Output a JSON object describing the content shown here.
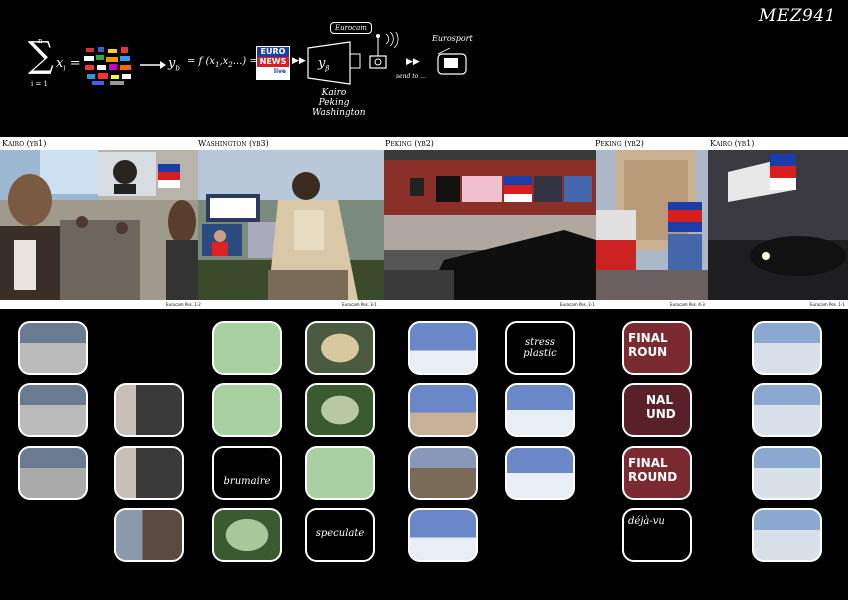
{
  "brand": "MEZ941",
  "formula": {
    "sum_top": "n",
    "sum_bottom": "i = 1",
    "xi": "x",
    "xi_sub": "i",
    "eq": "=",
    "yb": "y",
    "yb_sub": "b",
    "fx": "= f (x",
    "fx_sub1": "1",
    "fx_mid": ",x",
    "fx_sub2": "2",
    "fx_tail": "...) =",
    "ybeta": "y",
    "ybeta_sub": "β",
    "cities": [
      "Kairo",
      "Peking",
      "Washington"
    ],
    "send_to": "send to ...",
    "eurocam": "Eurocam",
    "eurosport": "Eurosport"
  },
  "euronews_logo": {
    "line1": "EURO",
    "line2": "NEWS",
    "line3": "live"
  },
  "strip": {
    "labels": [
      "Kairo (yb1)",
      "Washington (yb3)",
      "Peking (yb2)",
      "Peking (yb2)",
      "Kairo (yb1)"
    ],
    "footers": [
      "Eurocam Pos. 1-2",
      "Eurocam Pos. 3-1",
      "Eurocam Pos. 2-1",
      "Eurocam Pos. 4-3",
      "Eurocam Pos. 1-1"
    ]
  },
  "tv_words": [
    "stress plastic",
    "brumaire",
    "speculate",
    "déjà-vu"
  ],
  "final_round": [
    "FINAL ROUN",
    "NAL UND",
    "FINAL ROUND"
  ],
  "colors": {
    "euro_blue": "#1a3da8",
    "euro_red": "#d81e1e",
    "bg": "#000000"
  }
}
